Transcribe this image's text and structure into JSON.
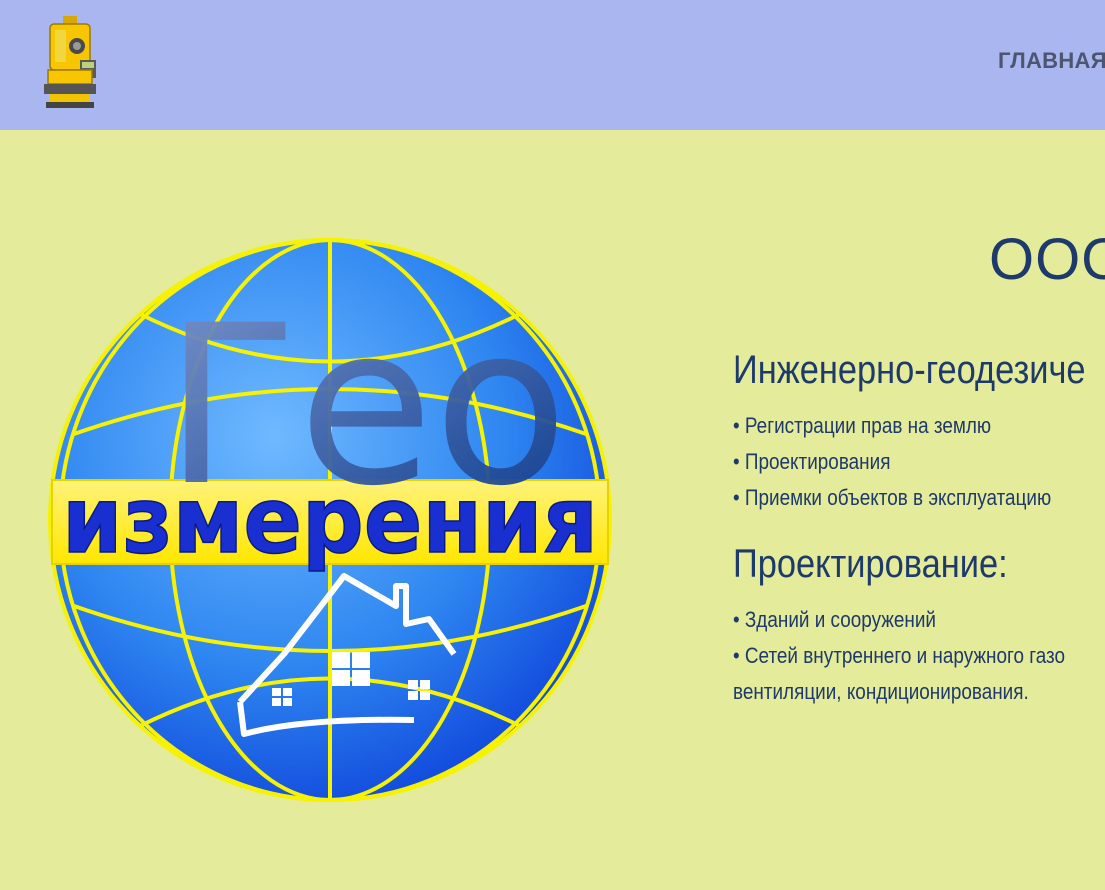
{
  "header": {
    "logo_icon": "total-station-icon",
    "nav": {
      "home_label": "ГЛАВНАЯ"
    }
  },
  "hero": {
    "logo": {
      "word1": "Гео",
      "word2": "измерения",
      "icon": "globe-house-logo"
    },
    "company_title": "ООО",
    "section1": {
      "title": "Инженерно-геодезиче",
      "items": [
        "• Регистрации прав на землю",
        "• Проектирования",
        "• Приемки объектов в эксплуатацию"
      ]
    },
    "section2": {
      "title": "Проектирование:",
      "items": [
        "• Зданий и сооружений",
        "• Сетей внутреннего и наружного газо",
        "вентиляции, кондиционирования."
      ]
    }
  },
  "colors": {
    "header_bg": "#a9b6ef",
    "page_bg": "#e4eb9a",
    "text": "#1e3a6b",
    "globe_blue": "#2f7ff0",
    "globe_lines": "#f4f000"
  }
}
